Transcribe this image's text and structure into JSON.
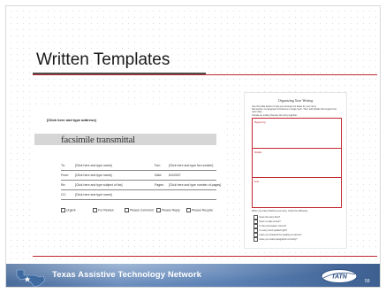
{
  "slide": {
    "title": "Written Templates",
    "page_number": "59"
  },
  "fax_template": {
    "sender_placeholder": "[Click here and type address]",
    "heading": "facsimile transmittal",
    "rows": [
      {
        "left_label": "To:",
        "left_value": "[Click here and type name]",
        "right_label": "Fax:",
        "right_value": "[Click here and type fax number]"
      },
      {
        "left_label": "From:",
        "left_value": "[Click here and type name]",
        "right_label": "Date:",
        "right_value": "6/4/2007"
      },
      {
        "left_label": "Re:",
        "left_value": "[Click here and type subject of fax]",
        "right_label": "Pages:",
        "right_value": "[Click here and type number of pages]"
      },
      {
        "left_label": "CC:",
        "left_value": "[Click here and type name]",
        "right_label": "",
        "right_value": ""
      }
    ],
    "checkboxes": [
      "Urgent",
      "For Review",
      "Please Comment",
      "Please Reply",
      "Please Recycle"
    ]
  },
  "organizer": {
    "title": "Organizing Your Writing",
    "instructions": [
      "Use the table below to help you arrange the ideas for your story.",
      "Remember: A paragraph introduces a single topic. Then add details that support the main idea.",
      "Include an ending that ties the story together."
    ],
    "sections": [
      "Beginning",
      "Middle",
      "End"
    ],
    "checklist_heading": "When you have finished your story, check the following:",
    "checklist": [
      "Does the story flow?",
      "Does it make sense?",
      "Is the punctuation correct?",
      "Is every word spelled right?",
      "Have you checked the spelling of names?",
      "Have you used paragraphs correctly?"
    ]
  },
  "footer": {
    "network_name": "Texas Assistive Technology Network",
    "logo_text": "TATN"
  },
  "colors": {
    "accent_red": "#c0282f",
    "footer_blue": "#5a80b3"
  }
}
